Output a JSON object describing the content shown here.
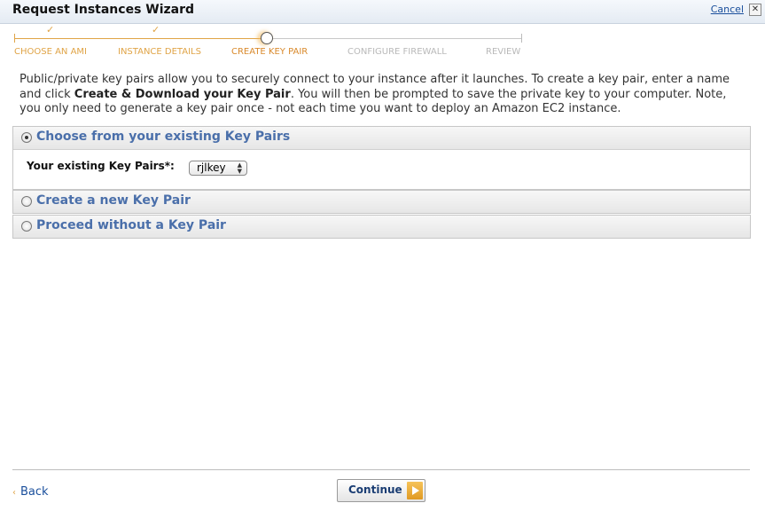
{
  "header": {
    "title": "Request Instances Wizard",
    "cancel_label": "Cancel",
    "close_glyph": "✕"
  },
  "steps": [
    {
      "label": "CHOOSE AN AMI",
      "state": "done"
    },
    {
      "label": "INSTANCE DETAILS",
      "state": "done"
    },
    {
      "label": "CREATE KEY PAIR",
      "state": "current"
    },
    {
      "label": "CONFIGURE FIREWALL",
      "state": "todo"
    },
    {
      "label": "REVIEW",
      "state": "todo"
    }
  ],
  "check_glyph": "✓",
  "description": {
    "part1": "Public/private key pairs allow you to securely connect to your instance after it launches. To create a key pair, enter a name and click ",
    "bold": "Create & Download your Key Pair",
    "part2": ". You will then be prompted to save the private key to your computer. Note, you only need to generate a key pair once - not each time you want to deploy an Amazon EC2 instance."
  },
  "options": {
    "existing": {
      "title": "Choose from your existing Key Pairs",
      "selected": true,
      "field_label": "Your existing Key Pairs*:",
      "select_value": "rjlkey"
    },
    "create_new": {
      "title": "Create a new Key Pair",
      "selected": false
    },
    "proceed_without": {
      "title": "Proceed without a Key Pair",
      "selected": false
    }
  },
  "footer": {
    "back_label": "Back",
    "back_glyph": "‹",
    "continue_label": "Continue"
  },
  "colors": {
    "accent_orange": "#e0a447",
    "link_blue": "#1a4f9c",
    "panel_title_blue": "#4a6faa"
  }
}
